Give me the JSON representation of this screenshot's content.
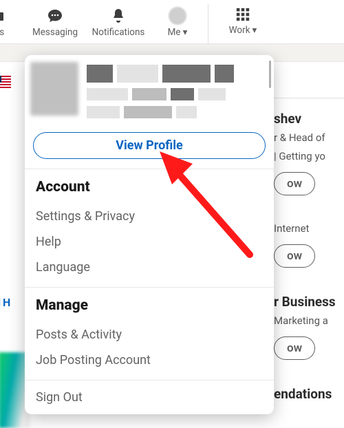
{
  "nav": {
    "jobs": "obs",
    "messaging": "Messaging",
    "notifications": "Notifications",
    "me": "Me",
    "work": "Work"
  },
  "dropdown": {
    "view_profile": "View Profile",
    "account_header": "Account",
    "account_items": [
      "Settings & Privacy",
      "Help",
      "Language"
    ],
    "manage_header": "Manage",
    "manage_items": [
      "Posts & Activity",
      "Job Posting Account"
    ],
    "sign_out": "Sign Out"
  },
  "right": {
    "name1": "shev",
    "desc1a": "r & Head of",
    "desc1b": "| Getting yo",
    "follow1": "ow",
    "cat2": "Internet",
    "follow2": "ow",
    "name3": "r Business",
    "desc3": "Marketing a",
    "follow3": "ow",
    "rec": "endations"
  },
  "left": {
    "dh": "d H"
  },
  "colors": {
    "link_blue": "#0a66c2",
    "arrow_red": "#ff1a1a"
  }
}
